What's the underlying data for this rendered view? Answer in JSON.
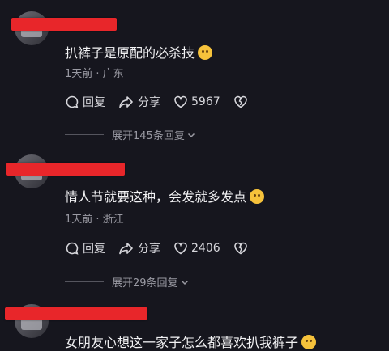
{
  "comments": [
    {
      "text": "扒裤子是原配的必杀技",
      "emoji_icon": "smirk-emoji",
      "meta": "1天前 · 广东",
      "reply_label": "回复",
      "share_label": "分享",
      "like_count": "5967",
      "expand_label": "展开145条回复"
    },
    {
      "text": "情人节就要这种，会发就多发点",
      "emoji_icon": "grin-sweat-emoji",
      "meta": "1天前 · 浙江",
      "reply_label": "回复",
      "share_label": "分享",
      "like_count": "2406",
      "expand_label": "展开29条回复"
    },
    {
      "text": "女朋友心想这一家子怎么都喜欢扒我裤子",
      "emoji_icon": "rofl-emoji"
    }
  ],
  "colors": {
    "background": "#16161e",
    "redaction": "#e8262a",
    "emoji": "#f6c23b"
  }
}
